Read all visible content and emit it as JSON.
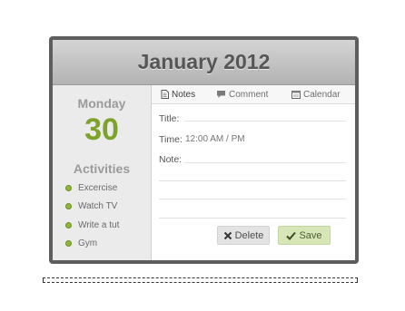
{
  "header": {
    "title": "January 2012"
  },
  "sidebar": {
    "day_name": "Monday",
    "day_number": "30",
    "activities_title": "Activities",
    "activities": [
      "Excercise",
      "Watch TV",
      "Write a tut",
      "Gym"
    ]
  },
  "tabs": [
    {
      "label": "Notes",
      "icon": "document-icon",
      "active": true
    },
    {
      "label": "Comment",
      "icon": "speech-bubble-icon",
      "active": false
    },
    {
      "label": "Calendar",
      "icon": "calendar-icon",
      "active": false
    }
  ],
  "form": {
    "title_label": "Title:",
    "time_label": "Time:",
    "time_placeholder": "12:00 AM / PM",
    "note_label": "Note:"
  },
  "buttons": {
    "delete": "Delete",
    "save": "Save"
  },
  "colors": {
    "accent": "#7ea32a",
    "frame": "#5e5e5e",
    "save_bg": "#d6e6b6"
  }
}
